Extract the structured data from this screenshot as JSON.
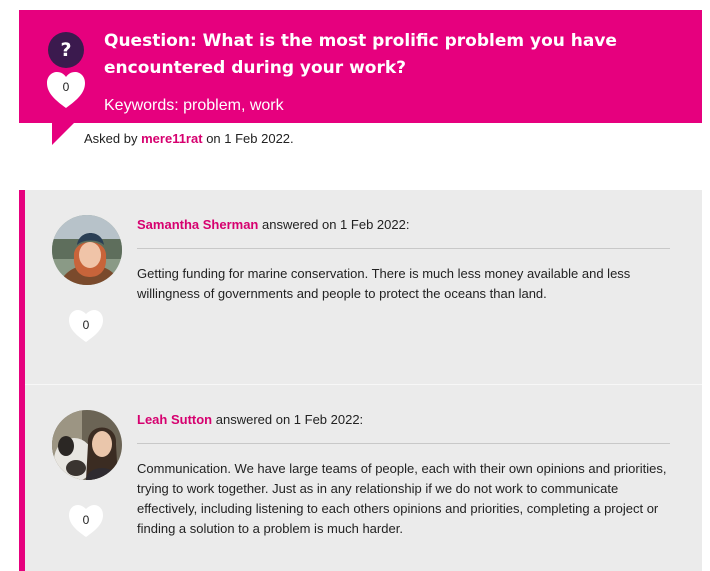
{
  "question": {
    "icon": "question-mark-icon",
    "mark": "?",
    "likes": "0",
    "title": "Question: What is the most prolific problem you have encountered during your work?",
    "keywords": "Keywords: problem, work",
    "asked_prefix": "Asked by",
    "asked_user": "mere11rat",
    "asked_suffix": "on 1 Feb 2022.",
    "accent": "#e6007e"
  },
  "answers": [
    {
      "user": "Samantha Sherman",
      "meta": "answered on 1 Feb 2022:",
      "text": "Getting funding for marine conservation. There is much less money available and less willingness of governments and people to protect the oceans than land.",
      "likes": "0"
    },
    {
      "user": "Leah Sutton",
      "meta": "answered on 1 Feb 2022:",
      "text": "Communication. We have large teams of people, each with their own opinions and priorities, trying to work together. Just as in any relationship if we do not work to communicate effectively, including listening to each others opinions and priorities, completing a project or finding a solution to a problem is much harder.",
      "likes": "0"
    }
  ]
}
